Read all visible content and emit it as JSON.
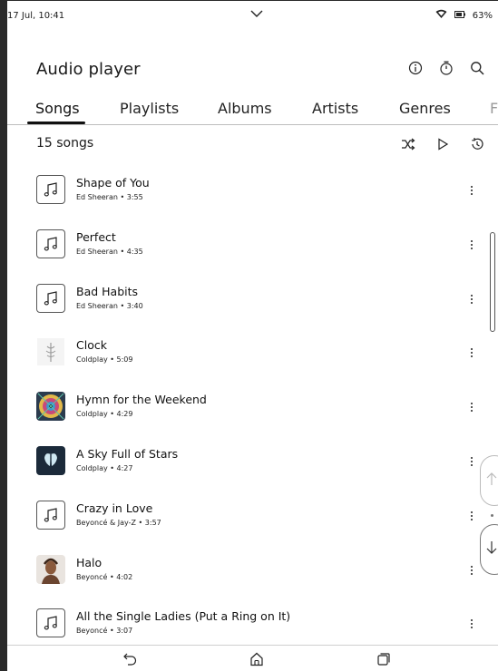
{
  "status_bar": {
    "time": "17 Jul, 10:41",
    "battery": "63%",
    "icons": [
      "chevron-down-icon",
      "wifi-icon",
      "battery-icon"
    ]
  },
  "header": {
    "title": "Audio player",
    "icons": [
      "info-icon",
      "timer-icon",
      "search-icon"
    ]
  },
  "tabs": [
    {
      "label": "Songs",
      "active": true
    },
    {
      "label": "Playlists"
    },
    {
      "label": "Albums"
    },
    {
      "label": "Artists"
    },
    {
      "label": "Genres"
    },
    {
      "label": "F"
    }
  ],
  "list_header": {
    "count": "15 songs",
    "icons": [
      "shuffle-icon",
      "play-icon",
      "history-icon"
    ]
  },
  "songs": [
    {
      "title": "Shape of You",
      "subtitle": "Ed Sheeran • 3:55",
      "thumb": "music-note-icon"
    },
    {
      "title": "Perfect",
      "subtitle": "Ed Sheeran • 4:35",
      "thumb": "music-note-icon"
    },
    {
      "title": "Bad Habits",
      "subtitle": "Ed Sheeran • 3:40",
      "thumb": "music-note-icon"
    },
    {
      "title": "Clock",
      "subtitle": "Coldplay • 5:09",
      "thumb": "album-art-clock"
    },
    {
      "title": "Hymn for the Weekend",
      "subtitle": "Coldplay • 4:29",
      "thumb": "album-art-hymn"
    },
    {
      "title": "A Sky Full of Stars",
      "subtitle": "Coldplay • 4:27",
      "thumb": "album-art-sky"
    },
    {
      "title": "Crazy in Love",
      "subtitle": "Beyoncé & Jay-Z • 3:57",
      "thumb": "music-note-icon"
    },
    {
      "title": "Halo",
      "subtitle": "Beyoncé • 4:02",
      "thumb": "album-art-halo"
    },
    {
      "title": "All the Single Ladies (Put a Ring on It)",
      "subtitle": "Beyoncé • 3:07",
      "thumb": "music-note-icon"
    }
  ],
  "scroll_buttons": [
    "arrow-up-icon",
    "arrow-down-icon"
  ],
  "nav_bar": [
    "back-icon",
    "home-icon",
    "recents-icon"
  ],
  "colors": {
    "text": "#1a1a1a",
    "border": "#555555",
    "background": "#ffffff"
  }
}
